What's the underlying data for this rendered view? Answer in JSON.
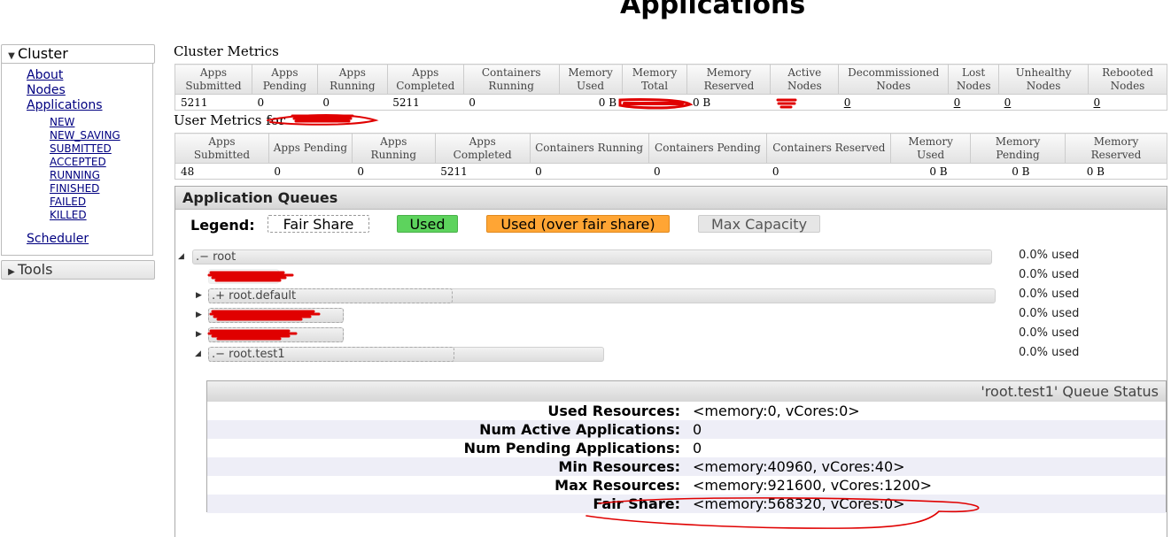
{
  "page_title": "Applications",
  "nav": {
    "cluster": {
      "label": "Cluster",
      "links": [
        "About",
        "Nodes",
        "Applications"
      ],
      "app_states": [
        "NEW",
        "NEW_SAVING",
        "SUBMITTED",
        "ACCEPTED",
        "RUNNING",
        "FINISHED",
        "FAILED",
        "KILLED"
      ],
      "scheduler": "Scheduler"
    },
    "tools": {
      "label": "Tools"
    }
  },
  "cluster_metrics": {
    "title": "Cluster Metrics",
    "headers": [
      "Apps Submitted",
      "Apps Pending",
      "Apps Running",
      "Apps Completed",
      "Containers Running",
      "Memory Used",
      "Memory Total",
      "Memory Reserved",
      "Active Nodes",
      "Decommissioned Nodes",
      "Lost Nodes",
      "Unhealthy Nodes",
      "Rebooted Nodes"
    ],
    "values": [
      "5211",
      "0",
      "0",
      "5211",
      "0",
      "0 B",
      "",
      "0 B",
      "",
      "0",
      "0",
      "0",
      "0"
    ]
  },
  "user_metrics": {
    "title": "User Metrics for",
    "headers": [
      "Apps Submitted",
      "Apps Pending",
      "Apps Running",
      "Apps Completed",
      "Containers Running",
      "Containers Pending",
      "Containers Reserved",
      "Memory Used",
      "Memory Pending",
      "Memory Reserved"
    ],
    "values": [
      "48",
      "0",
      "0",
      "5211",
      "0",
      "0",
      "0",
      "0 B",
      "0 B",
      "0 B"
    ]
  },
  "queues": {
    "title": "Application Queues",
    "legend": {
      "label": "Legend:",
      "fair_share": "Fair Share",
      "used": "Used",
      "over": "Used (over fair share)",
      "max": "Max Capacity"
    },
    "items": [
      {
        "name": ".− root",
        "pct": "0.0% used"
      },
      {
        "name": "",
        "pct": "0.0% used"
      },
      {
        "name": ".+ root.default",
        "pct": "0.0% used"
      },
      {
        "name": "",
        "pct": "0.0% used"
      },
      {
        "name": "",
        "pct": "0.0% used"
      },
      {
        "name": ".− root.test1",
        "pct": "0.0% used"
      }
    ],
    "colors": {
      "used": "#5dd35d",
      "over": "#ffa534",
      "max": "#e6e6e6",
      "annotation": "#e00000"
    }
  },
  "queue_status": {
    "title": "'root.test1' Queue Status",
    "rows": [
      {
        "key": "Used Resources:",
        "value": "<memory:0, vCores:0>"
      },
      {
        "key": "Num Active Applications:",
        "value": "0"
      },
      {
        "key": "Num Pending Applications:",
        "value": "0"
      },
      {
        "key": "Min Resources:",
        "value": "<memory:40960, vCores:40>"
      },
      {
        "key": "Max Resources:",
        "value": "<memory:921600, vCores:1200>"
      },
      {
        "key": "Fair Share:",
        "value": "<memory:568320, vCores:0>"
      }
    ]
  }
}
